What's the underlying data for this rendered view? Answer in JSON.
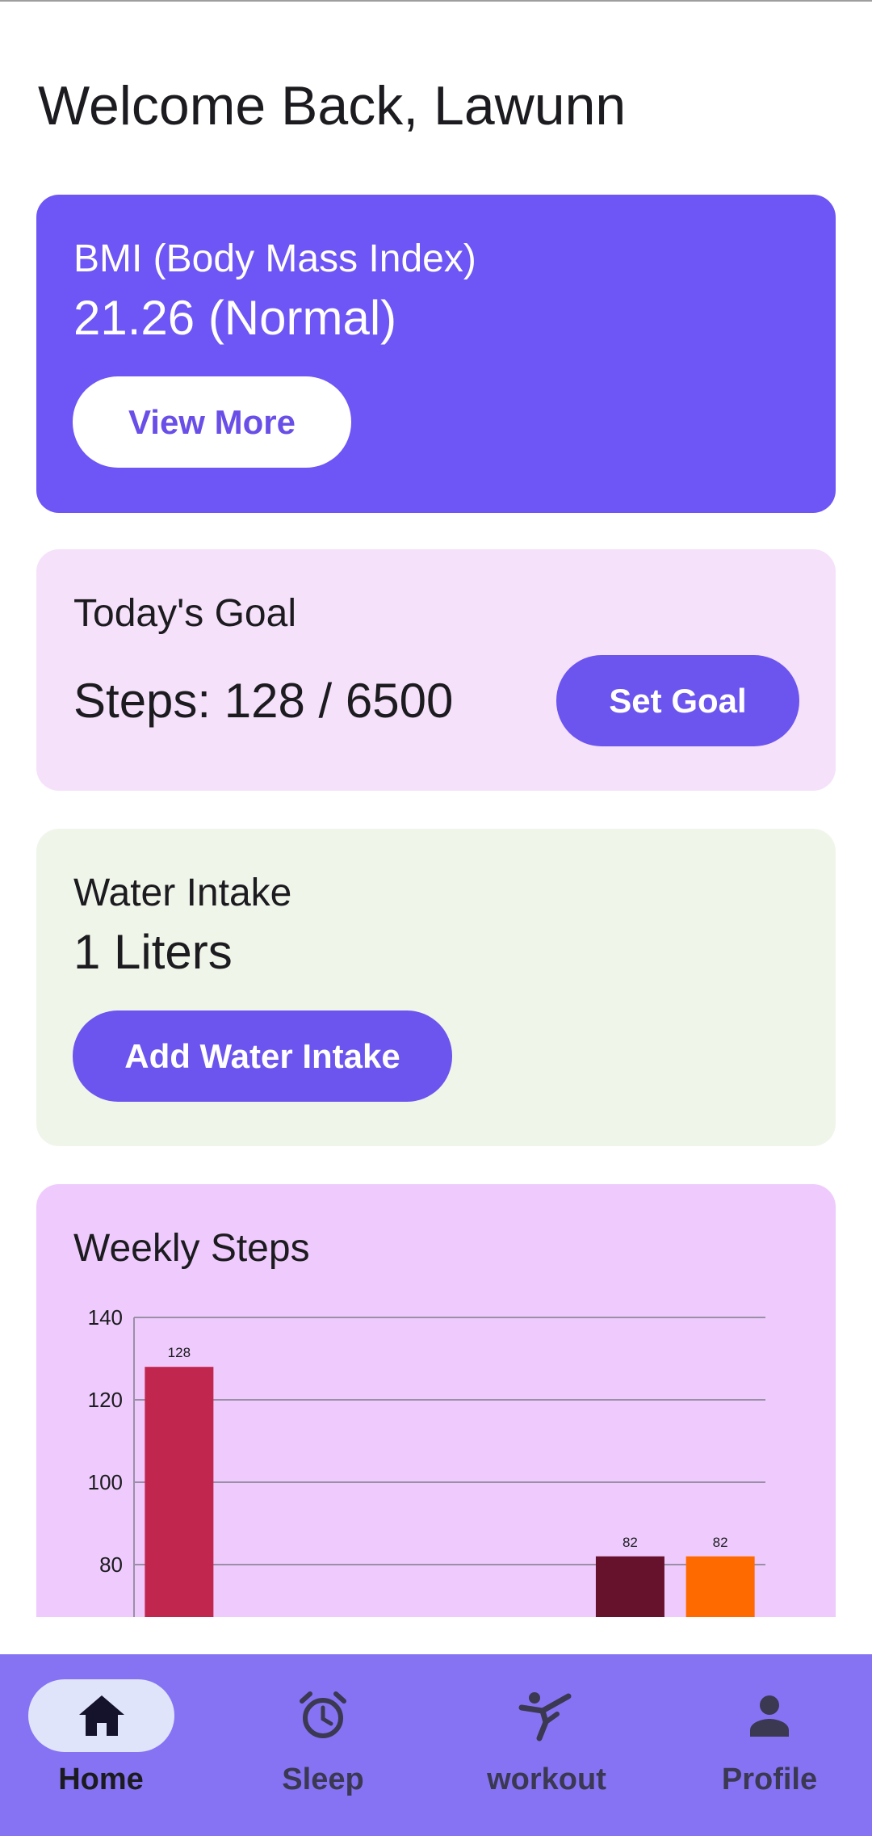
{
  "greeting": "Welcome Back, Lawunn",
  "bmi": {
    "title": "BMI (Body Mass Index)",
    "value": "21.26 (Normal)",
    "button_label": "View More"
  },
  "goal": {
    "title": "Today's Goal",
    "steps_text": "Steps: 128 / 6500",
    "button_label": "Set Goal"
  },
  "water": {
    "title": "Water Intake",
    "value": "1 Liters",
    "button_label": "Add Water Intake"
  },
  "chart_title": "Weekly Steps",
  "chart_data": {
    "type": "bar",
    "y_ticks": [
      140,
      120,
      100,
      80
    ],
    "ylim_visible": [
      67,
      140
    ],
    "bars": [
      {
        "slot": 0,
        "value": 128,
        "label": "128",
        "color": "#c1264f"
      },
      {
        "slot": 5,
        "value": 82,
        "label": "82",
        "color": "#66122d"
      },
      {
        "slot": 6,
        "value": 82,
        "label": "82",
        "color": "#ff6a00"
      }
    ],
    "slots": 7
  },
  "nav": {
    "items": [
      {
        "label": "Home",
        "icon": "home-icon",
        "active": true
      },
      {
        "label": "Sleep",
        "icon": "alarm-clock-icon",
        "active": false
      },
      {
        "label": "workout",
        "icon": "martial-arts-icon",
        "active": false
      },
      {
        "label": "Profile",
        "icon": "person-icon",
        "active": false
      }
    ]
  },
  "colors": {
    "primary": "#6e55f5",
    "nav_bg": "#8573f4",
    "goal_bg": "#f6e1fb",
    "water_bg": "#f0f5ea",
    "chart_bg": "#eecbfc"
  }
}
